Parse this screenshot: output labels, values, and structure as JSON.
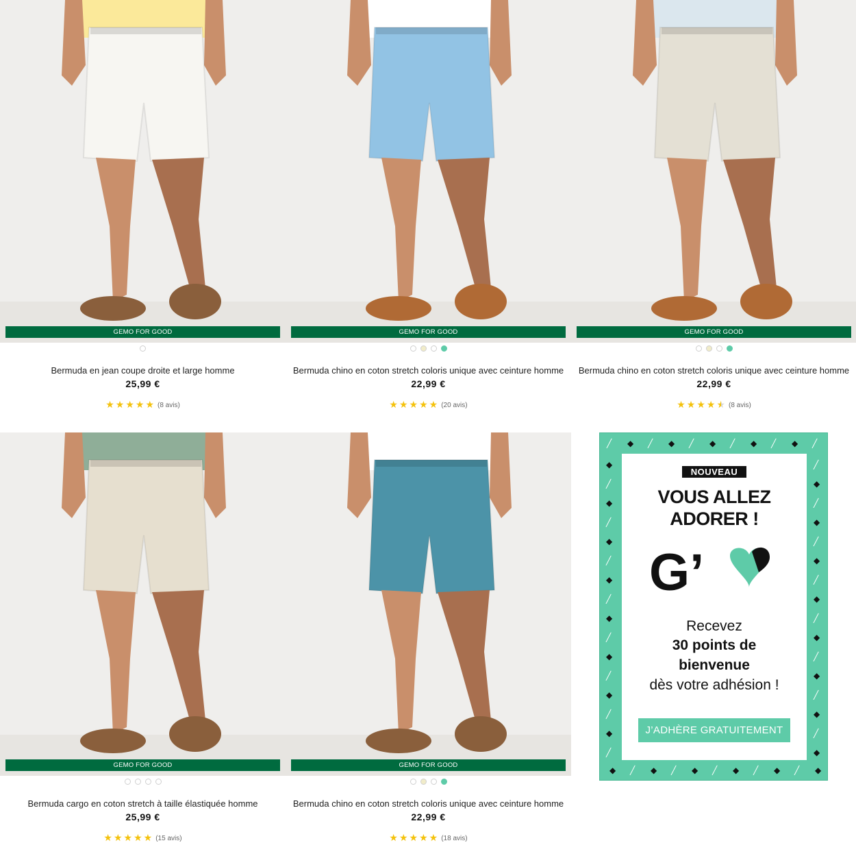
{
  "products": [
    {
      "banner": "GEMO FOR GOOD",
      "title": "Bermuda en jean coupe droite et large homme",
      "price": "25,99 €",
      "reviews": "(8 avis)",
      "rating": 5,
      "swatch_colors": [
        "#ffffff"
      ],
      "short_color": "#f7f6f2",
      "top_color": "#fbe99a",
      "shoe": "sandal"
    },
    {
      "banner": "GEMO FOR GOOD",
      "title": "Bermuda chino en coton stretch coloris unique avec ceinture homme",
      "price": "22,99 €",
      "reviews": "(20 avis)",
      "rating": 5,
      "swatch_colors": [
        "#ffffff",
        "#f1ecc9",
        "#ffffff",
        "#5ecba8"
      ],
      "short_color": "#92c3e4",
      "top_color": "#ffffff",
      "shoe": "loafer"
    },
    {
      "banner": "GEMO FOR GOOD",
      "title": "Bermuda chino en coton stretch coloris unique avec ceinture homme",
      "price": "22,99 €",
      "reviews": "(8 avis)",
      "rating": 4.5,
      "swatch_colors": [
        "#ffffff",
        "#f1ecc9",
        "#ffffff",
        "#5ecba8"
      ],
      "short_color": "#e4e0d4",
      "top_color": "#dbe7ee",
      "shoe": "loafer"
    },
    {
      "banner": "GEMO FOR GOOD",
      "title": "Bermuda cargo en coton stretch à taille élastiquée homme",
      "price": "25,99 €",
      "reviews": "(15 avis)",
      "rating": 5,
      "swatch_colors": [
        "#ffffff",
        "#ffffff",
        "#ffffff",
        "#ffffff"
      ],
      "short_color": "#e6dfcf",
      "top_color": "#8fae98",
      "shoe": "sandal"
    },
    {
      "banner": "GEMO FOR GOOD",
      "title": "Bermuda chino en coton stretch coloris unique avec ceinture homme",
      "price": "22,99 €",
      "reviews": "(18 avis)",
      "rating": 5,
      "swatch_colors": [
        "#ffffff",
        "#f1ecc9",
        "#ffffff",
        "#5ecba8"
      ],
      "short_color": "#4c93a8",
      "top_color": "#ffffff",
      "shoe": "sandal"
    }
  ],
  "promo": {
    "badge": "NOUVEAU",
    "headline_line1": "VOUS ALLEZ",
    "headline_line2": "ADORER !",
    "logo_letter": "G’",
    "text_line1": "Recevez",
    "text_line2": "30 points de",
    "text_line3": "bienvenue",
    "text_line4": "dès votre adhésion !",
    "button": "J’ADHÈRE GRATUITEMENT"
  },
  "colors": {
    "banner_green": "#006b3f",
    "star_yellow": "#f4c20d",
    "promo_mint": "#5ecba8"
  }
}
